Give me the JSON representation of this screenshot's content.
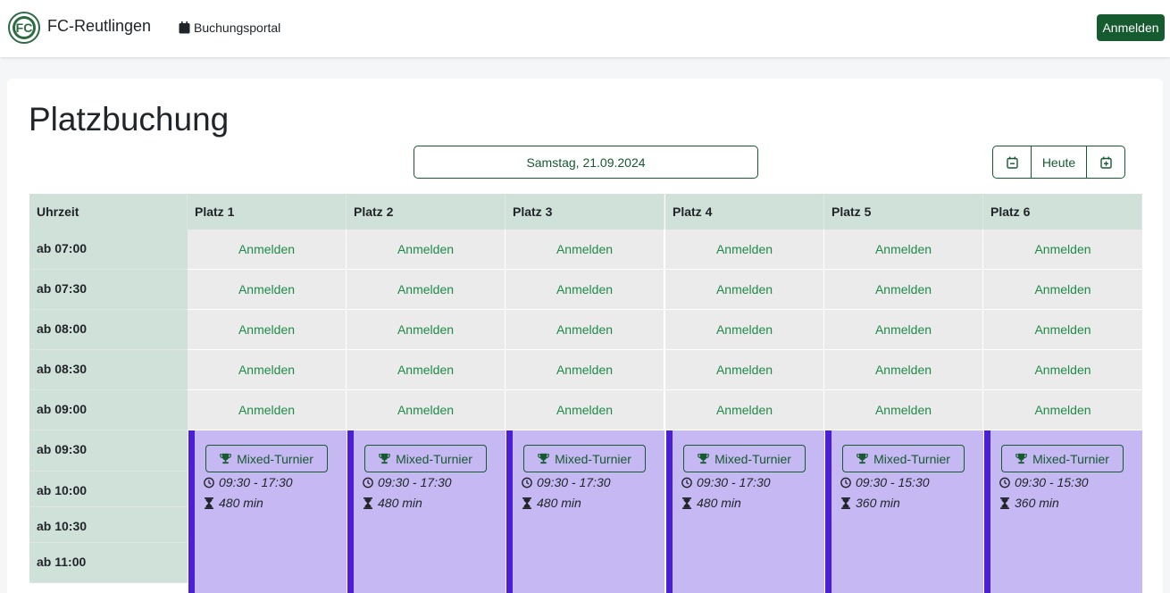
{
  "navbar": {
    "brand": "FC-Reutlingen",
    "portal_link": "Buchungsportal",
    "login_button": "Anmelden"
  },
  "page": {
    "title": "Platzbuchung",
    "date": "Samstag, 21.09.2024",
    "today_button": "Heute"
  },
  "table": {
    "time_header": "Uhrzeit",
    "courts": [
      "Platz 1",
      "Platz 2",
      "Platz 3",
      "Platz 4",
      "Platz 5",
      "Platz 6"
    ],
    "times": [
      "ab 07:00",
      "ab 07:30",
      "ab 08:00",
      "ab 08:30",
      "ab 09:00",
      "ab 09:30",
      "ab 10:00",
      "ab 10:30",
      "ab 11:00"
    ],
    "book_label": "Anmelden",
    "events": [
      {
        "title": "Mixed-Turnier",
        "time": "09:30 - 17:30",
        "duration": "480 min"
      },
      {
        "title": "Mixed-Turnier",
        "time": "09:30 - 17:30",
        "duration": "480 min"
      },
      {
        "title": "Mixed-Turnier",
        "time": "09:30 - 17:30",
        "duration": "480 min"
      },
      {
        "title": "Mixed-Turnier",
        "time": "09:30 - 17:30",
        "duration": "480 min"
      },
      {
        "title": "Mixed-Turnier",
        "time": "09:30 - 15:30",
        "duration": "360 min"
      },
      {
        "title": "Mixed-Turnier",
        "time": "09:30 - 15:30",
        "duration": "360 min"
      }
    ]
  },
  "colors": {
    "primary": "#165a30",
    "header_bg": "#cfe1d8",
    "slot_bg": "#ebebeb",
    "event_bg": "#c6b8f2",
    "event_border": "#4a1fd6"
  },
  "icons": {
    "portal": "calendar-icon",
    "prev": "calendar-minus-icon",
    "next": "calendar-plus-icon",
    "event": "trophy-icon",
    "time": "clock-icon",
    "duration": "hourglass-icon"
  }
}
